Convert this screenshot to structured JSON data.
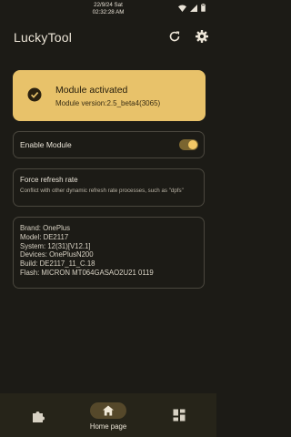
{
  "status_bar": {
    "date": "22/9/24 Sat",
    "time": "02:32:28 AM",
    "battery_percent": 0.9
  },
  "app": {
    "title": "LuckyTool",
    "actions": [
      "refresh-icon",
      "gear-icon"
    ]
  },
  "module_status": {
    "title": "Module activated",
    "version": "Module version:2.5_beta4(3065)",
    "icon": "check-circle-icon",
    "color": "#e8c26a"
  },
  "enable_module": {
    "label": "Enable Module",
    "enabled": true
  },
  "force_refresh": {
    "title": "Force refresh rate",
    "description": "Conflict with other dynamic refresh rate processes, such as \"dpfs\""
  },
  "device_info": {
    "lines": [
      "Brand: OnePlus",
      "Model: DE2117",
      "System: 12(31)[V12.1]",
      "Devices: OnePlusN200",
      "Build: DE2117_11_C.18",
      "Flash: MICRON  MT064GASAO2U21  0119"
    ]
  },
  "bottom_nav": {
    "items": [
      {
        "icon": "puzzle-icon",
        "label": ""
      },
      {
        "icon": "home-icon",
        "label": "Home page",
        "selected": true
      },
      {
        "icon": "grid-icon",
        "label": ""
      }
    ]
  }
}
